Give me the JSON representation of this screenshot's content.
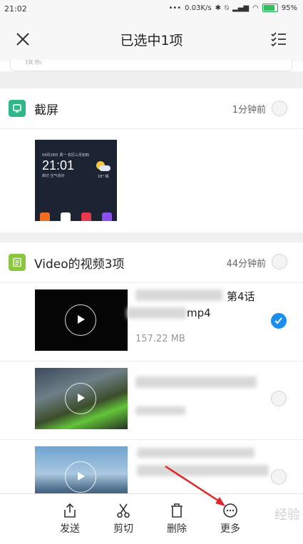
{
  "status_bar": {
    "time": "21:02",
    "dots": "•••",
    "network_speed": "0.03K/s",
    "battery": "95%"
  },
  "header": {
    "title": "已选中1项"
  },
  "search": {
    "placeholder": "搜索"
  },
  "groups": [
    {
      "title": "截屏",
      "time": "1分钟前",
      "icon": "screenshot-icon",
      "icon_color": "#2fb78a"
    },
    {
      "title": "Video的视频3项",
      "time": "44分钟前",
      "icon": "document-icon",
      "icon_color": "#8cc63f"
    }
  ],
  "screenshot_preview": {
    "top_text": "04月18日 周一 农历三月初四",
    "clock": "21:01",
    "sub_text": "廊坊 空气良好",
    "temp": "18° 晴"
  },
  "videos": [
    {
      "name_suffix": "第4话",
      "ext": "mp4",
      "size": "157.22 MB",
      "selected": true
    },
    {
      "selected": false
    },
    {
      "selected": false
    }
  ],
  "toolbar": [
    {
      "label": "发送",
      "icon": "share-icon"
    },
    {
      "label": "剪切",
      "icon": "scissors-icon"
    },
    {
      "label": "删除",
      "icon": "trash-icon"
    },
    {
      "label": "更多",
      "icon": "more-icon"
    }
  ],
  "colors": {
    "accent": "#1a8ef0",
    "arrow": "#e0262b"
  },
  "watermark": "经验"
}
